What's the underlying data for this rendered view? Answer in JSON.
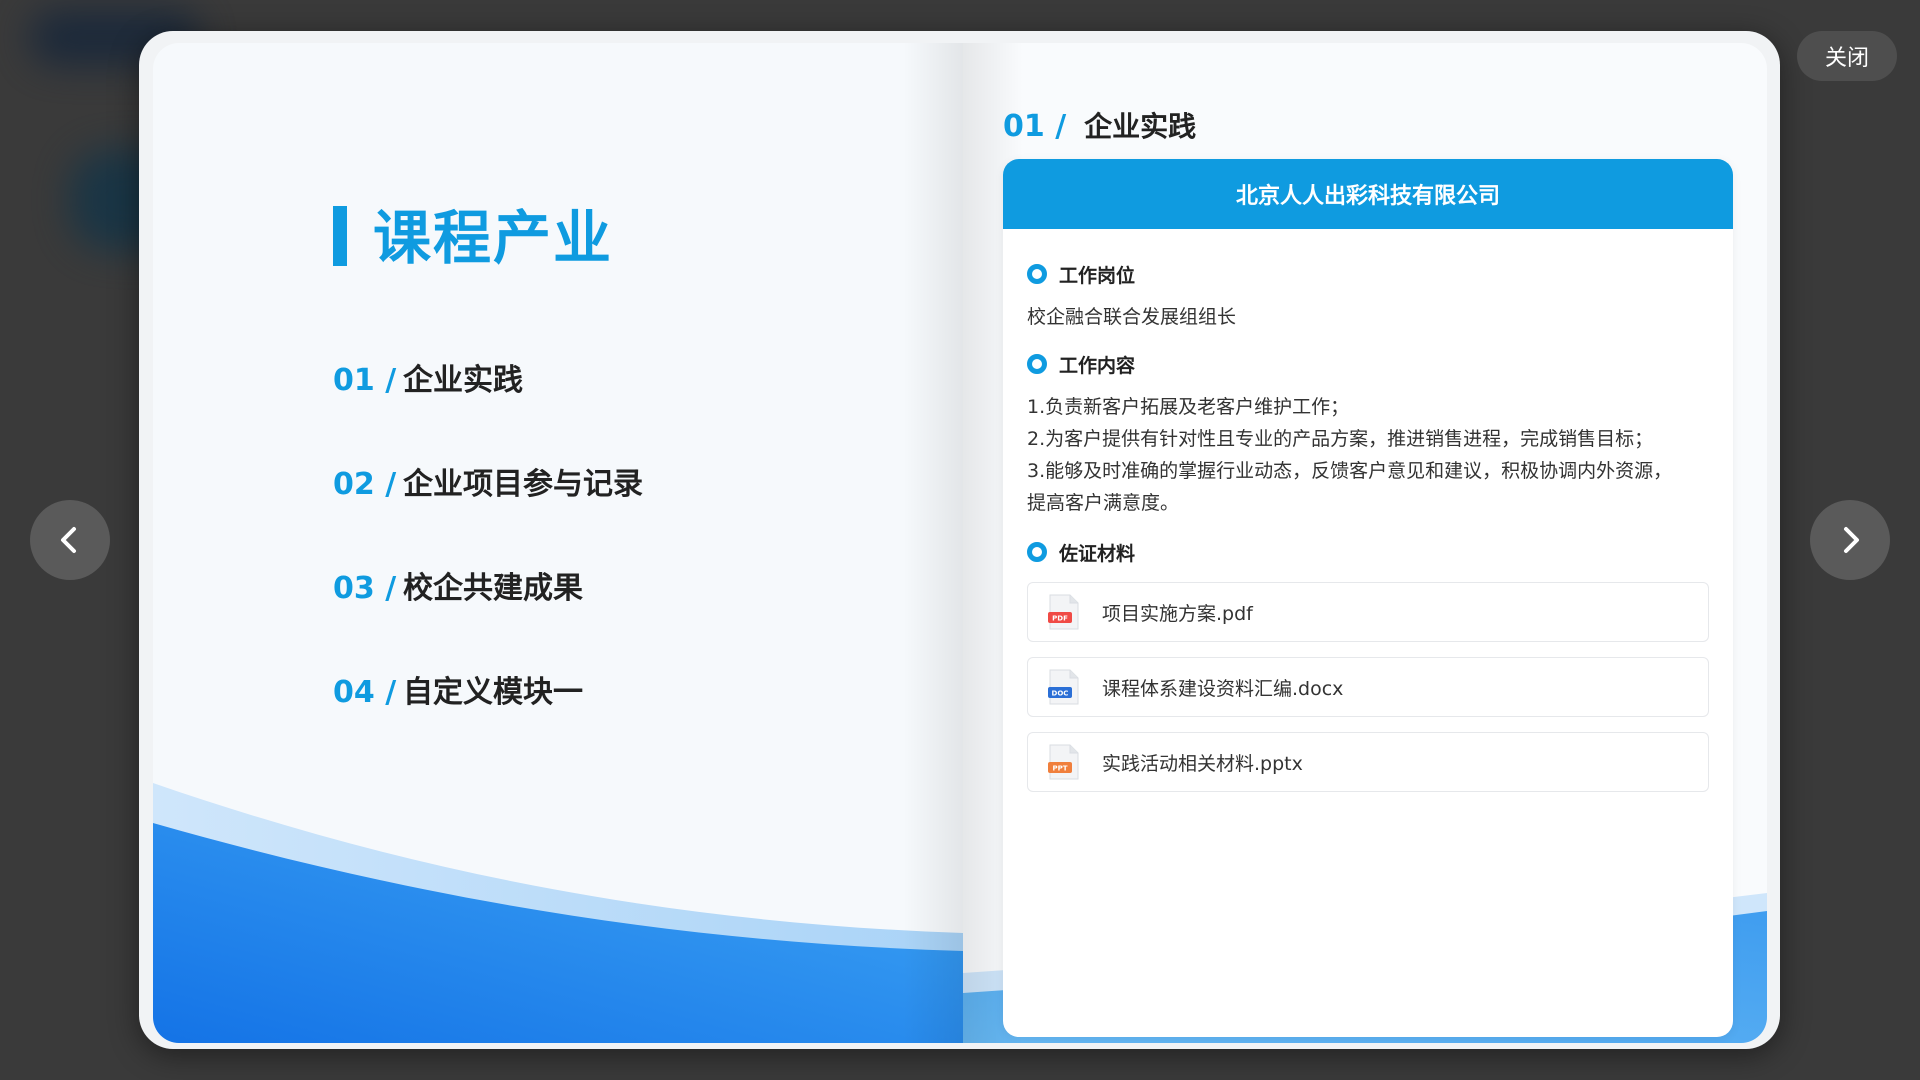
{
  "colors": {
    "accent": "#0f9be0",
    "text_dark": "#222222",
    "text_body": "#333333",
    "overlay": "#3a3a3a"
  },
  "overlay": {
    "close_label": "关闭",
    "prev_icon": "chevron-left-icon",
    "next_icon": "chevron-right-icon"
  },
  "left_page": {
    "title": "课程产业",
    "toc": [
      {
        "num": "01 /",
        "label": "企业实践"
      },
      {
        "num": "02 /",
        "label": "企业项目参与记录"
      },
      {
        "num": "03 /",
        "label": "校企共建成果"
      },
      {
        "num": "04 /",
        "label": "自定义模块一"
      }
    ]
  },
  "right_page": {
    "section_num": "01 /",
    "section_title": "企业实践",
    "company": "北京人人出彩科技有限公司",
    "job_title_label": "工作岗位",
    "job_title": "校企融合联合发展组组长",
    "duties_label": "工作内容",
    "duties": [
      "1.负责新客户拓展及老客户维护工作；",
      "2.为客户提供有针对性且专业的产品方案，推进销售进程，完成销售目标；",
      "3.能够及时准确的掌握行业动态，反馈客户意见和建议，积极协调内外资源，",
      "提高客户满意度。"
    ],
    "materials_label": "佐证材料",
    "files": [
      {
        "name": "项目实施方案.pdf",
        "type": "PDF",
        "color": "#f04a45",
        "icon": "pdf-file-icon"
      },
      {
        "name": "课程体系建设资料汇编.docx",
        "type": "DOC",
        "color": "#2b6fd6",
        "icon": "doc-file-icon"
      },
      {
        "name": "实践活动相关材料.pptx",
        "type": "PPT",
        "color": "#f07f3c",
        "icon": "ppt-file-icon"
      }
    ]
  }
}
